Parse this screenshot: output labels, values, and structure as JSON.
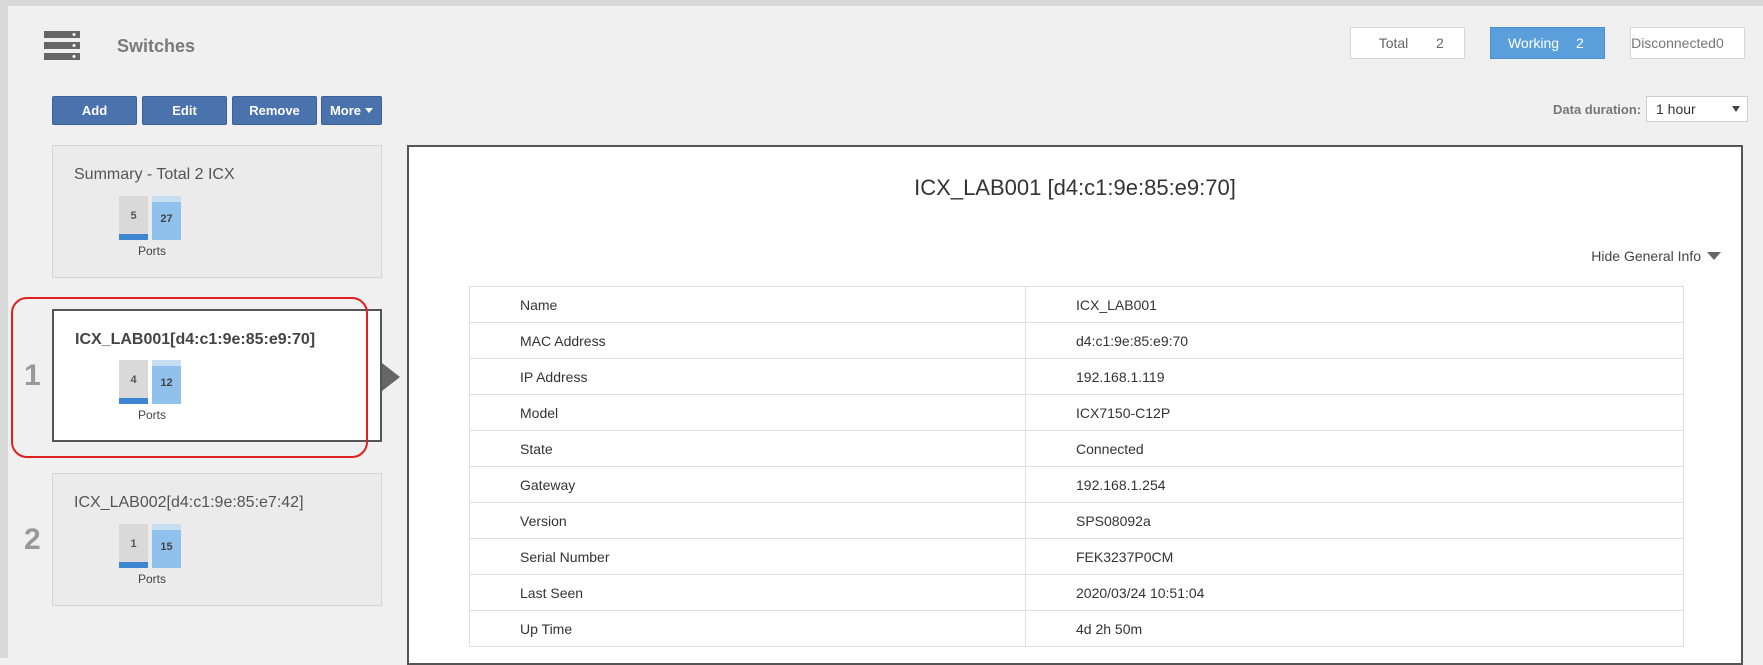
{
  "header": {
    "title": "Switches",
    "icon": "server-rack-icon"
  },
  "stats": {
    "total": {
      "label": "Total",
      "count": "2"
    },
    "working": {
      "label": "Working",
      "count": "2"
    },
    "disconnected": {
      "label": "Disconnected",
      "count": "0"
    }
  },
  "toolbar": {
    "add": "Add",
    "edit": "Edit",
    "remove": "Remove",
    "more": "More"
  },
  "duration": {
    "label": "Data duration:",
    "value": "1 hour"
  },
  "cards": [
    {
      "title": "Summary - Total 2 ICX",
      "port_a": "5",
      "port_b": "27",
      "ports_label": "Ports"
    },
    {
      "index": "1",
      "title": "ICX_LAB001[d4:c1:9e:85:e9:70]",
      "port_a": "4",
      "port_b": "12",
      "ports_label": "Ports"
    },
    {
      "index": "2",
      "title": "ICX_LAB002[d4:c1:9e:85:e7:42]",
      "port_a": "1",
      "port_b": "15",
      "ports_label": "Ports"
    }
  ],
  "detail": {
    "title": "ICX_LAB001 [d4:c1:9e:85:e9:70]",
    "toggle": "Hide General Info",
    "rows": [
      {
        "key": "Name",
        "value": "ICX_LAB001"
      },
      {
        "key": "MAC Address",
        "value": "d4:c1:9e:85:e9:70"
      },
      {
        "key": "IP Address",
        "value": "192.168.1.119"
      },
      {
        "key": "Model",
        "value": "ICX7150-C12P"
      },
      {
        "key": "State",
        "value": "Connected"
      },
      {
        "key": "Gateway",
        "value": "192.168.1.254"
      },
      {
        "key": "Version",
        "value": "SPS08092a"
      },
      {
        "key": "Serial Number",
        "value": "FEK3237P0CM"
      },
      {
        "key": "Last Seen",
        "value": "2020/03/24 10:51:04"
      },
      {
        "key": "Up Time",
        "value": "4d 2h 50m"
      }
    ]
  },
  "colors": {
    "button": "#4a72ad",
    "working": "#5a9fdb",
    "highlight": "#e02020"
  }
}
